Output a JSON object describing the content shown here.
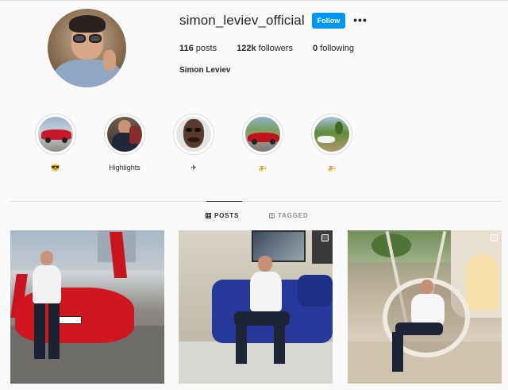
{
  "profile": {
    "username": "simon_leviev_official",
    "follow_label": "Follow",
    "more_label": "•••",
    "stats": {
      "posts_count": "116",
      "posts_label": " posts",
      "followers_count": "122k",
      "followers_label": " followers",
      "following_count": "0",
      "following_label": " following"
    },
    "full_name": "Simon Leviev"
  },
  "highlights": [
    {
      "label": "😎",
      "icon": "red-car-photo"
    },
    {
      "label": "Highlights",
      "icon": "man-portrait-photo"
    },
    {
      "label": "✈",
      "icon": "face-closeup-photo"
    },
    {
      "label": "🚁",
      "icon": "red-sportscar-photo"
    },
    {
      "label": "🚁",
      "icon": "white-car-field-photo"
    }
  ],
  "tabs": [
    {
      "label": "POSTS",
      "icon": "grid-icon",
      "active": true
    },
    {
      "label": "TAGGED",
      "icon": "tag-icon",
      "active": false
    }
  ],
  "posts": [
    {
      "icon": "man-with-red-lamborghini-photo",
      "multi": false
    },
    {
      "icon": "man-on-blue-sofa-photo",
      "multi": true
    },
    {
      "icon": "man-in-hanging-chair-photo",
      "multi": true
    }
  ],
  "colors": {
    "accent": "#0095f6",
    "background": "#fafafa",
    "text": "#262626",
    "muted": "#8e8e8e",
    "border": "#dbdbdb"
  }
}
